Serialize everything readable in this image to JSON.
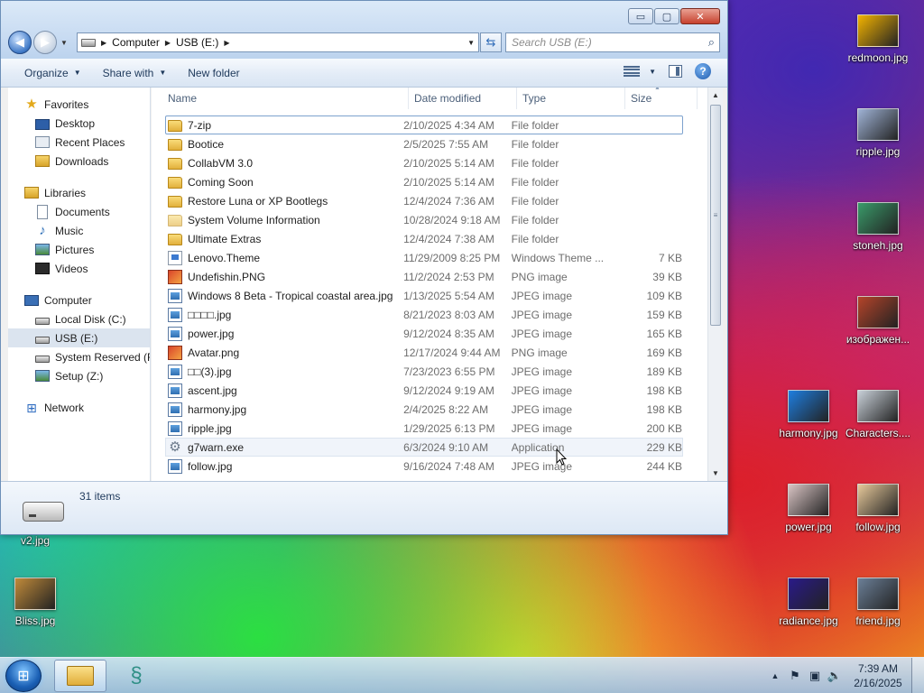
{
  "window": {
    "caption": {
      "minimize": "▭",
      "maximize": "▢",
      "close": "✕"
    },
    "address": {
      "crumbs": [
        "Computer",
        "USB (E:)"
      ]
    },
    "search": {
      "placeholder": "Search USB (E:)"
    },
    "toolbar": {
      "organize": "Organize",
      "share_with": "Share with",
      "new_folder": "New folder"
    },
    "columns": {
      "name": "Name",
      "date": "Date modified",
      "type": "Type",
      "size": "Size"
    },
    "nav": {
      "favorites": "Favorites",
      "favorites_items": [
        "Desktop",
        "Recent Places",
        "Downloads"
      ],
      "libraries": "Libraries",
      "libraries_items": [
        "Documents",
        "Music",
        "Pictures",
        "Videos"
      ],
      "computer": "Computer",
      "computer_items": [
        "Local Disk (C:)",
        "USB (E:)",
        "System Reserved (F:)",
        "Setup (Z:)"
      ],
      "network": "Network"
    },
    "files": [
      {
        "name": "7-zip",
        "date": "2/10/2025 4:34 AM",
        "type": "File folder",
        "size": "",
        "icon": "folder"
      },
      {
        "name": "Bootice",
        "date": "2/5/2025 7:55 AM",
        "type": "File folder",
        "size": "",
        "icon": "folder"
      },
      {
        "name": "CollabVM 3.0",
        "date": "2/10/2025 5:14 AM",
        "type": "File folder",
        "size": "",
        "icon": "folder"
      },
      {
        "name": "Coming Soon",
        "date": "2/10/2025 5:14 AM",
        "type": "File folder",
        "size": "",
        "icon": "folder"
      },
      {
        "name": "Restore Luna or XP Bootlegs",
        "date": "12/4/2024 7:36 AM",
        "type": "File folder",
        "size": "",
        "icon": "folder"
      },
      {
        "name": "System Volume Information",
        "date": "10/28/2024 9:18 AM",
        "type": "File folder",
        "size": "",
        "icon": "folder-faded"
      },
      {
        "name": "Ultimate Extras",
        "date": "12/4/2024 7:38 AM",
        "type": "File folder",
        "size": "",
        "icon": "folder"
      },
      {
        "name": "Lenovo.Theme",
        "date": "11/29/2009 8:25 PM",
        "type": "Windows Theme ...",
        "size": "7 KB",
        "icon": "theme"
      },
      {
        "name": "Undefishin.PNG",
        "date": "11/2/2024 2:53 PM",
        "type": "PNG image",
        "size": "39 KB",
        "icon": "png"
      },
      {
        "name": "Windows 8 Beta - Tropical coastal area.jpg",
        "date": "1/13/2025 5:54 AM",
        "type": "JPEG image",
        "size": "109 KB",
        "icon": "jpg"
      },
      {
        "name": "□□□□.jpg",
        "date": "8/21/2023 8:03 AM",
        "type": "JPEG image",
        "size": "159 KB",
        "icon": "jpg"
      },
      {
        "name": "power.jpg",
        "date": "9/12/2024 8:35 AM",
        "type": "JPEG image",
        "size": "165 KB",
        "icon": "jpg"
      },
      {
        "name": "Avatar.png",
        "date": "12/17/2024 9:44 AM",
        "type": "PNG image",
        "size": "169 KB",
        "icon": "png"
      },
      {
        "name": "□□(3).jpg",
        "date": "7/23/2023 6:55 PM",
        "type": "JPEG image",
        "size": "189 KB",
        "icon": "jpg"
      },
      {
        "name": "ascent.jpg",
        "date": "9/12/2024 9:19 AM",
        "type": "JPEG image",
        "size": "198 KB",
        "icon": "jpg"
      },
      {
        "name": "harmony.jpg",
        "date": "2/4/2025 8:22 AM",
        "type": "JPEG image",
        "size": "198 KB",
        "icon": "jpg"
      },
      {
        "name": "ripple.jpg",
        "date": "1/29/2025 6:13 PM",
        "type": "JPEG image",
        "size": "200 KB",
        "icon": "jpg"
      },
      {
        "name": "g7warn.exe",
        "date": "6/3/2024 9:10 AM",
        "type": "Application",
        "size": "229 KB",
        "icon": "exe"
      },
      {
        "name": "follow.jpg",
        "date": "9/16/2024 7:48 AM",
        "type": "JPEG image",
        "size": "244 KB",
        "icon": "jpg"
      }
    ],
    "status": {
      "count": "31 items"
    }
  },
  "desktop": {
    "icons": [
      {
        "label": "redmoon.jpg",
        "color": "#f4b400"
      },
      {
        "label": "ripple.jpg",
        "color": "#9fb3d6"
      },
      {
        "label": "stoneh.jpg",
        "color": "#3a9b6a"
      },
      {
        "label": "изображен...",
        "color": "#b5442a"
      },
      {
        "label": "harmony.jpg",
        "color": "#1e7ee0"
      },
      {
        "label": "Characters....",
        "color": "#c8d0d8"
      },
      {
        "label": "power.jpg",
        "color": "#d9c4c4"
      },
      {
        "label": "follow.jpg",
        "color": "#e7c99a"
      },
      {
        "label": "radiance.jpg",
        "color": "#2a1a8a"
      },
      {
        "label": "friend.jpg",
        "color": "#6b7f97"
      },
      {
        "label": "v2.jpg",
        "color": "#6d8fb8"
      },
      {
        "label": "Bliss.jpg",
        "color": "#c08a3a"
      }
    ]
  },
  "taskbar": {
    "clock_time": "7:39 AM",
    "clock_date": "2/16/2025",
    "tray": {
      "chevron": "▲",
      "flag": "⚑",
      "network": "▣",
      "volume": "🔈"
    }
  }
}
